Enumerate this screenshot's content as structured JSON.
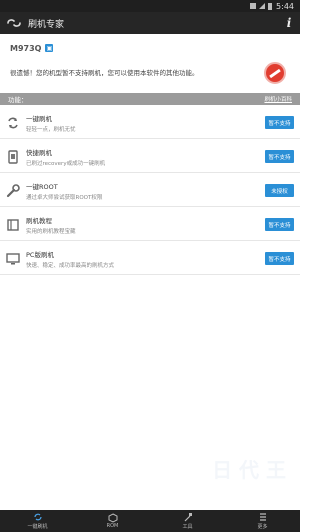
{
  "statusbar": {
    "time": "5:44"
  },
  "app": {
    "title": "刷机专家",
    "info_icon": "i"
  },
  "device": {
    "model": "M973Q",
    "icon": "phone-badge-icon"
  },
  "warning": {
    "text": "很遗憾！您的机型暂不支持刷机，您可以使用本软件的其他功能。"
  },
  "features": {
    "heading": "功能：",
    "help": "刷机小百科",
    "items": [
      {
        "name": "一键刷机",
        "desc": "轻轻一点，刷机无忧",
        "button": "暂不支持",
        "icon": "recycle-icon"
      },
      {
        "name": "快捷刷机",
        "desc": "已刷过recovery或成功一键刷机",
        "button": "暂不支持",
        "icon": "phone-icon"
      },
      {
        "name": "一键ROOT",
        "desc": "通过卓大师尝试获取ROOT权限",
        "button": "未授权",
        "icon": "wrench-icon"
      },
      {
        "name": "刷机教程",
        "desc": "实用的刷机教程宝藏",
        "button": "暂不支持",
        "icon": "book-icon"
      },
      {
        "name": "PC版刷机",
        "desc": "快速、稳定、成功率最高的刷机方式",
        "button": "暂不支持",
        "icon": "monitor-icon"
      }
    ]
  },
  "bottomnav": {
    "items": [
      {
        "label": "一键刷机",
        "icon": "refresh-icon"
      },
      {
        "label": "ROM",
        "icon": "cube-icon"
      },
      {
        "label": "工具",
        "icon": "hammer-icon"
      },
      {
        "label": "更多",
        "icon": "menu-icon"
      }
    ]
  },
  "watermark": "日 代 王"
}
